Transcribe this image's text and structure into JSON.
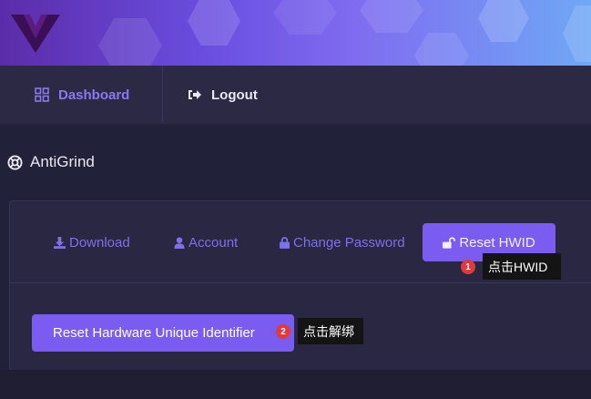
{
  "brand": {
    "logo_icon": "v-logo-icon",
    "colors": {
      "accent": "#7a5cf0",
      "banner_start": "#5b2ca8",
      "banner_end": "#6fa8f5",
      "background": "#22213a"
    }
  },
  "nav": {
    "dashboard": {
      "label": "Dashboard",
      "icon": "grid-icon"
    },
    "logout": {
      "label": "Logout",
      "icon": "sign-out-icon"
    }
  },
  "section": {
    "title": "AntiGrind",
    "icon": "lifebuoy-icon"
  },
  "tabs": [
    {
      "label": "Download",
      "icon": "download-icon"
    },
    {
      "label": "Account",
      "icon": "user-icon"
    },
    {
      "label": "Change Password",
      "icon": "lock-icon"
    },
    {
      "label": "Reset HWID",
      "icon": "unlock-icon",
      "active": true
    }
  ],
  "action": {
    "reset_button_label": "Reset Hardware Unique Identifier"
  },
  "annotations": [
    {
      "number": "1",
      "text": "点击HWID"
    },
    {
      "number": "2",
      "text": "点击解绑"
    }
  ]
}
